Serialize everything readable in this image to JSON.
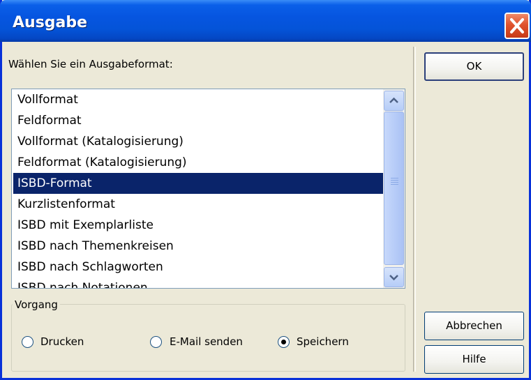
{
  "window": {
    "title": "Ausgabe"
  },
  "prompt_label": "Wählen Sie ein Ausgabeformat:",
  "formats": {
    "items": [
      "Vollformat",
      "Feldformat",
      "Vollformat (Katalogisierung)",
      "Feldformat (Katalogisierung)",
      "ISBD-Format",
      "Kurzlistenformat",
      "ISBD mit Exemplarliste",
      "ISBD nach Themenkreisen",
      "ISBD nach Schlagworten",
      "ISBD nach Notationen"
    ],
    "selected": "ISBD-Format"
  },
  "vorgang": {
    "label": "Vorgang",
    "options": [
      "Drucken",
      "E-Mail senden",
      "Speichern"
    ],
    "selected": "Speichern"
  },
  "buttons": {
    "ok": "OK",
    "cancel": "Abbrechen",
    "help": "Hilfe"
  },
  "colors": {
    "selection": "#0a246a",
    "titlebar": "#0454d8",
    "close": "#e0532e"
  },
  "icons": {
    "close": "close-icon",
    "scroll_up": "chevron-up-icon",
    "scroll_down": "chevron-down-icon"
  }
}
